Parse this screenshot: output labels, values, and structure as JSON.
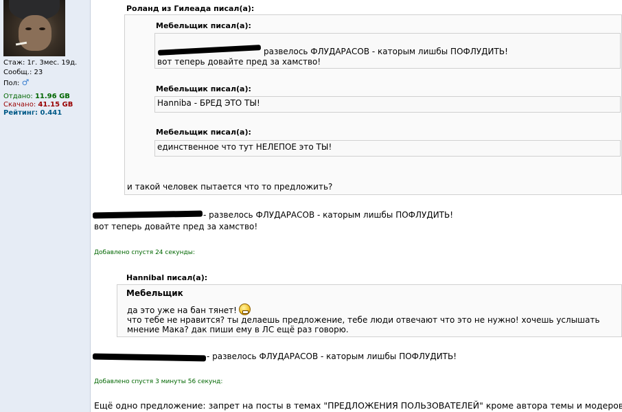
{
  "profile": {
    "stazh": "Стаж: 1г. 3мес. 19д.",
    "soobsh": "Сообщ.: 23",
    "pol_label": "Пол:",
    "pol_icon": "♂",
    "otdano_label": "Отдано:",
    "otdano_value": "11.96 GB",
    "skachano_label": "Скачано:",
    "skachano_value": "41.15 GB",
    "rating_label": "Рейтинг:",
    "rating_value": "0.441"
  },
  "post": {
    "outer_quote": {
      "author": "Роланд из Гилеада писал(а):",
      "nested": [
        {
          "author": "Мебельщик писал(а):",
          "line1": "развелось ФЛУДАРАСОВ - каторым лишбы ПОФЛУДИТЬ!",
          "line2": "вот теперь довайте пред за хамство!"
        },
        {
          "author": "Мебельщик писал(а):",
          "line1": "Hanniba - БРЕД ЭТО ТЫ!"
        },
        {
          "author": "Мебельщик писал(а):",
          "line1": "единственное что тут НЕЛЕПОЕ это ТЫ!"
        }
      ],
      "footer": "и такой человек пытается что то предложить?"
    },
    "reply1": {
      "line1": "- развелось ФЛУДАРАСОВ - каторым лишбы ПОФЛУДИТЬ!",
      "line2": "вот теперь довайте пред за хамство!"
    },
    "added1": "Добавлено спустя 24 секунды:",
    "hannibal_quote": {
      "author": "Hannibal писал(а):",
      "name": "Мебельщик",
      "line1": "да это уже на бан тянет!",
      "line2": "что тебе не нравится? ты делаешь предложение, тебе люди отвечают что это не нужно! хочешь услышать",
      "line3": "мнение Мака? дак пиши ему в ЛС ещё раз говорю."
    },
    "reply2": "- развелось ФЛУДАРАСОВ - каторым лишбы ПОФЛУДИТЬ!",
    "added2": "Добавлено спустя 3 минуты 56 секунд:",
    "last_line": "Ещё одно предложение: запрет на посты в темах \"ПРЕДЛОЖЕНИЯ ПОЛЬЗОВАТЕЛЕЙ\" кроме автора темы и модеров. -"
  },
  "icons": [
    "male-icon",
    "grin-smiley-icon"
  ],
  "colors": {
    "sidebar_bg": "#e6ecf5",
    "green": "#006600",
    "red": "#990000",
    "blue": "#005a88"
  }
}
